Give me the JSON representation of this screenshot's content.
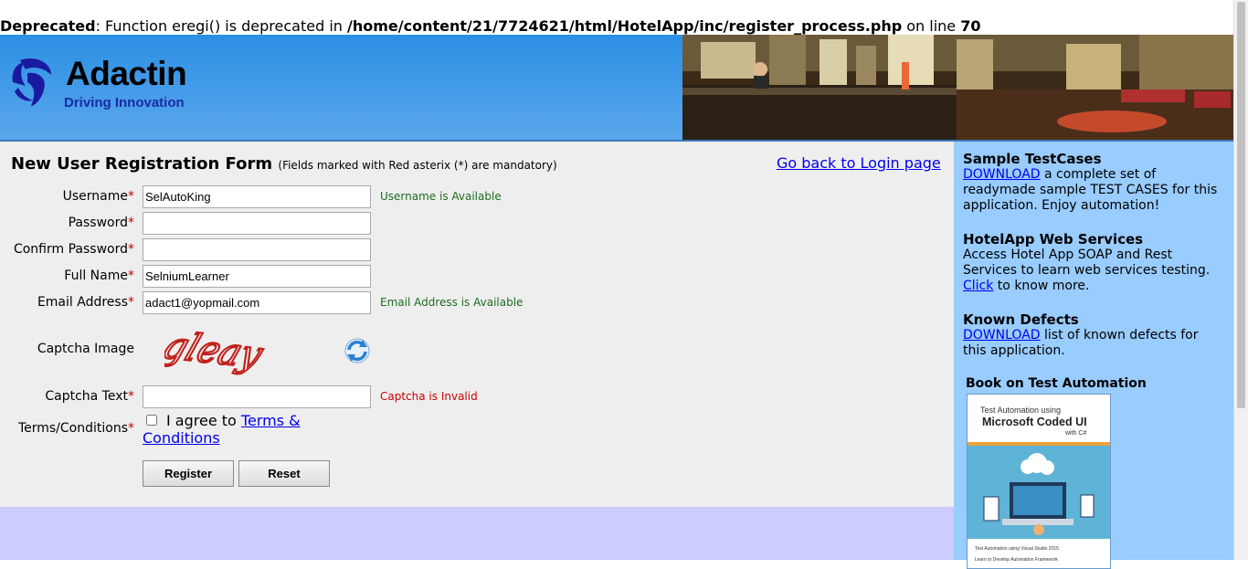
{
  "warning": {
    "level": "Deprecated",
    "message": ": Function eregi() is deprecated in ",
    "path": "/home/content/21/7724621/html/HotelApp/inc/register_process.php",
    "line_text": " on line ",
    "line": "70"
  },
  "logo": {
    "name": "Adactin",
    "tagline": "Driving Innovation"
  },
  "form": {
    "title": "New User Registration Form",
    "note": "(Fields marked with Red asterix (*) are mandatory)",
    "back_link": "Go back to Login page",
    "required_mark": "*",
    "labels": {
      "username": "Username",
      "password": "Password",
      "confirm_password": "Confirm Password",
      "full_name": "Full Name",
      "email": "Email Address",
      "captcha_image": "Captcha Image",
      "captcha_text": "Captcha Text",
      "terms": "Terms/Conditions"
    },
    "values": {
      "username": "SelAutoKing",
      "password": "",
      "confirm_password": "",
      "full_name": "SelniumLearner",
      "email": "adact1@yopmail.com",
      "captcha_text": ""
    },
    "captcha_word": "gleay",
    "messages": {
      "username": "Username is Available",
      "email": "Email Address is Available",
      "captcha": "Captcha is Invalid"
    },
    "agree_text": "I agree to",
    "agree_link": "Terms & Conditions",
    "register_button": "Register",
    "reset_button": "Reset"
  },
  "sidebar": {
    "testcases": {
      "heading": "Sample TestCases",
      "link": "DOWNLOAD",
      "text": " a complete set of readymade sample TEST CASES for this application. Enjoy automation!"
    },
    "webservices": {
      "heading": "HotelApp Web Services",
      "text": "Access Hotel App SOAP and Rest Services to learn web services testing. ",
      "link": "Click",
      "text_after": " to know more."
    },
    "defects": {
      "heading": "Known Defects",
      "link": "DOWNLOAD",
      "text": " list of known defects for this application."
    },
    "book": {
      "heading": "Book on Test Automation",
      "cover_line1": "Test Automation using",
      "cover_line2": "Microsoft Coded UI",
      "cover_line3": "with C#",
      "cover_bullet1": "Test Automation using Visual Studio 2015",
      "cover_bullet2": "Learn to Develop Automation Framework"
    }
  }
}
